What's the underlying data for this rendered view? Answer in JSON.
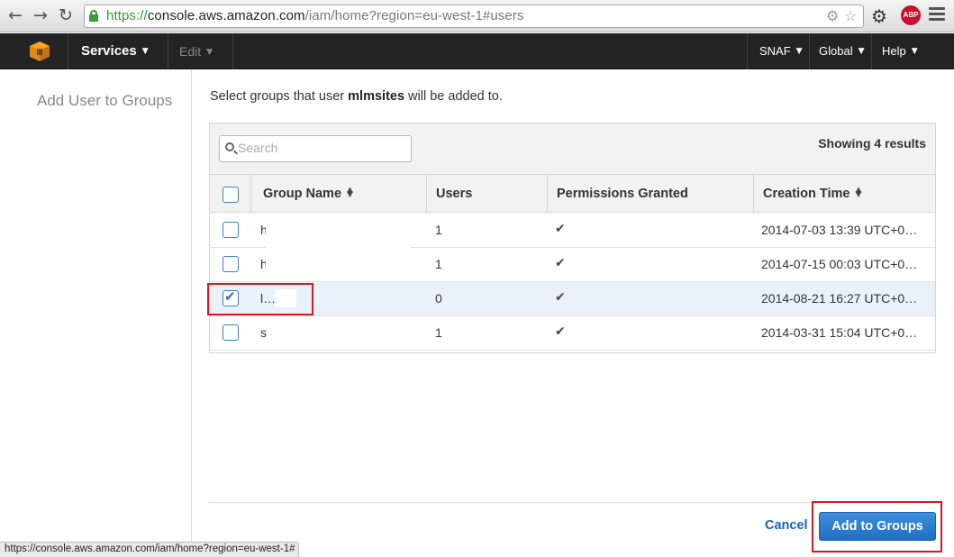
{
  "browser": {
    "url_scheme": "https://",
    "url_host": "console.aws.amazon.com",
    "url_path": "/iam/home?region=eu-west-1#users",
    "abp_label": "ABP",
    "status_url": "https://console.aws.amazon.com/iam/home?region=eu-west-1#"
  },
  "nav": {
    "services": "Services",
    "edit": "Edit",
    "account": "SNAF",
    "region": "Global",
    "help": "Help"
  },
  "sidebar": {
    "title": "Add User to Groups"
  },
  "main": {
    "prompt_prefix": "Select groups that user ",
    "user": "mlmsites",
    "prompt_suffix": " will be added to.",
    "search_placeholder": "Search",
    "showing": "Showing 4 results"
  },
  "table": {
    "columns": [
      "Group Name",
      "Users",
      "Permissions Granted",
      "Creation Time"
    ],
    "rows": [
      {
        "name": "h",
        "users": "1",
        "permissions": "✔",
        "created": "2014-07-03 13:39 UTC+0…",
        "checked": false
      },
      {
        "name": "h                         d",
        "users": "1",
        "permissions": "✔",
        "created": "2014-07-15 00:03 UTC+0…",
        "checked": false
      },
      {
        "name": "l…..",
        "users": "0",
        "permissions": "✔",
        "created": "2014-08-21 16:27 UTC+0…",
        "checked": true
      },
      {
        "name": "s",
        "users": "1",
        "permissions": "✔",
        "created": "2014-03-31 15:04 UTC+0…",
        "checked": false
      }
    ]
  },
  "actions": {
    "cancel": "Cancel",
    "add": "Add to Groups"
  },
  "colors": {
    "accent": "#1f6ec4",
    "highlight": "#d6191f",
    "nav_bg": "#232323"
  }
}
